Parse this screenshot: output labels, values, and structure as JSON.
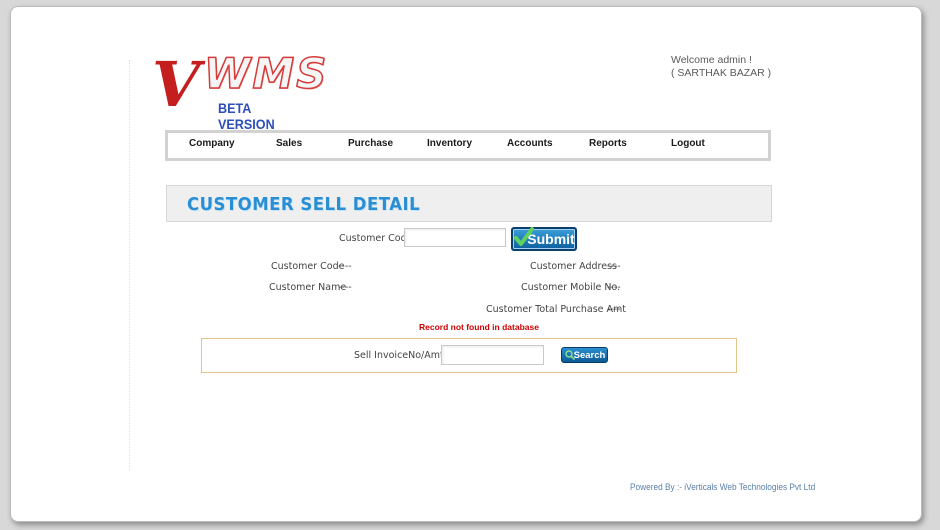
{
  "brand": {
    "logo_letter": "V",
    "logo_text": "WMS",
    "version_label": "BETA VERSION"
  },
  "header": {
    "welcome_line1": "Welcome admin !",
    "welcome_line2": "( SARTHAK BAZAR )"
  },
  "nav": {
    "items": [
      {
        "label": "Company"
      },
      {
        "label": "Sales"
      },
      {
        "label": "Purchase"
      },
      {
        "label": "Inventory"
      },
      {
        "label": "Accounts"
      },
      {
        "label": "Reports"
      },
      {
        "label": "Logout"
      }
    ]
  },
  "page": {
    "title": "CUSTOMER SELL DETAIL"
  },
  "customer_form": {
    "code_label": "Customer Code:",
    "code_value": "",
    "submit_label": "Submit"
  },
  "customer_info": {
    "code_label": "Customer Code",
    "code_value": "----",
    "name_label": "Customer Name",
    "name_value": "----",
    "address_label": "Customer Address",
    "address_value": "----",
    "mobile_label": "Customer Mobile No.",
    "mobile_value": "----",
    "total_label": "Customer Total Purchase Amt",
    "total_value": "----"
  },
  "status": {
    "message": "Record not found in database"
  },
  "search": {
    "label": "Sell InvoiceNo/Amt :",
    "value": "",
    "button_label": "Search"
  },
  "footer": {
    "text": "Powered By :- iVerticals Web Technologies Pvt Ltd"
  },
  "colors": {
    "accent": "#2a8ed4",
    "button": "#0d5f9e",
    "error": "#cc0000",
    "logo_red": "#c41e1e",
    "version_blue": "#2c4fb8"
  }
}
